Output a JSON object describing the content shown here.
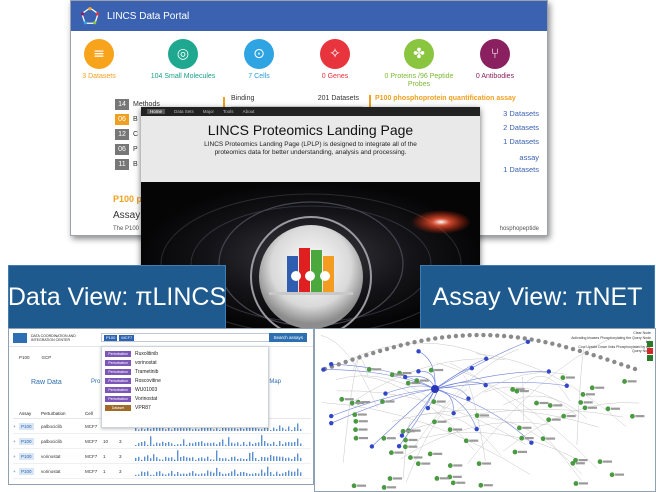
{
  "portal": {
    "title": "LINCS Data Portal",
    "stats": [
      {
        "label": "3 Datasets",
        "icon": "document-grid-icon",
        "color": "#f7a31c",
        "text_color": "#f0a020"
      },
      {
        "label": "104 Small Molecules",
        "icon": "molecule-icon",
        "color": "#1ea88f",
        "text_color": "#1a9e87"
      },
      {
        "label": "7 Cells",
        "icon": "cell-icon",
        "color": "#2ea4e2",
        "text_color": "#2a9ad6"
      },
      {
        "label": "0 Genes",
        "icon": "dna-icon",
        "color": "#e8343c",
        "text_color": "#e8343c"
      },
      {
        "label": "0 Proteins /96 Peptide Probes",
        "icon": "protein-icon",
        "color": "#8ac53f",
        "text_color": "#7cb834"
      },
      {
        "label": "0 Antibodies",
        "icon": "antibody-icon",
        "color": "#8b2060",
        "text_color": "#8b2060"
      }
    ],
    "categories": [
      {
        "num": "14",
        "label": "Methods"
      },
      {
        "num": "06",
        "label": "B"
      },
      {
        "num": "12",
        "label": "C"
      },
      {
        "num": "06",
        "label": "P"
      },
      {
        "num": "11",
        "label": "B"
      }
    ],
    "binding": {
      "label": "Binding",
      "value": "201 Datasets"
    },
    "assay_panel": {
      "title": "P100 phosphoprotein quantification assay",
      "items": [
        "3 Datasets",
        "2 Datasets",
        "1 Datasets",
        "assay",
        "1 Datasets"
      ]
    },
    "p100_heading": "P100 p",
    "assay_heading": "Assay I",
    "assay_text": "The P100",
    "phospho_text": "hosphopeptide"
  },
  "landing": {
    "nav": [
      "Home",
      "Data Sets",
      "Major",
      "Tools",
      "About"
    ],
    "title": "LINCS Proteomics Landing Page",
    "description": "LINCS Proteomics Landing Page (LPLP) is designed to integrate all of the proteomics data for better understanding, analysis and processing."
  },
  "banners": {
    "left": "Data View: πLINCS",
    "right": "Assay View: πNET"
  },
  "dataview": {
    "org": "DATA COORDINATION AND INTEGRATION CENTER",
    "search_chips": [
      "P100",
      "MCF7"
    ],
    "search_button": "Search assays",
    "tabs": [
      "P100",
      "GCP"
    ],
    "dropdown": [
      {
        "tag": "Perturbation",
        "label": "Ruxolitinib"
      },
      {
        "tag": "Perturbation",
        "label": "vorinostat"
      },
      {
        "tag": "Perturbation",
        "label": "Trametinib"
      },
      {
        "tag": "Perturbation",
        "label": "Roscovitine"
      },
      {
        "tag": "Perturbation",
        "label": "WU01003"
      },
      {
        "tag": "Perturbation",
        "label": "Vorinostat"
      },
      {
        "tag": "Dataset",
        "label": "VPR87"
      }
    ],
    "raw_data": "Raw Data",
    "pro_link": "Pro",
    "heatmap_link": "eatMap",
    "columns": [
      "Assay",
      "Perturbation",
      "Cell",
      "Dose",
      "Time",
      "Profile"
    ],
    "rows": [
      {
        "assay": "P100",
        "pert": "palbociclib",
        "cell": "MCF7",
        "dose": "10",
        "time": "3"
      },
      {
        "assay": "P100",
        "pert": "palbociclib",
        "cell": "MCF7",
        "dose": "10",
        "time": "3"
      },
      {
        "assay": "P100",
        "pert": "vorinostat",
        "cell": "MCF7",
        "dose": "1",
        "time": "3"
      },
      {
        "assay": "P100",
        "pert": "vorinostat",
        "cell": "MCF7",
        "dose": "1",
        "time": "3"
      }
    ]
  },
  "netview": {
    "legend": [
      "Clear Node",
      "Activating kinases  Phosphorylating the Query Node link",
      "Cool Upside Down links  Phosphorylated by the Query Node"
    ]
  }
}
